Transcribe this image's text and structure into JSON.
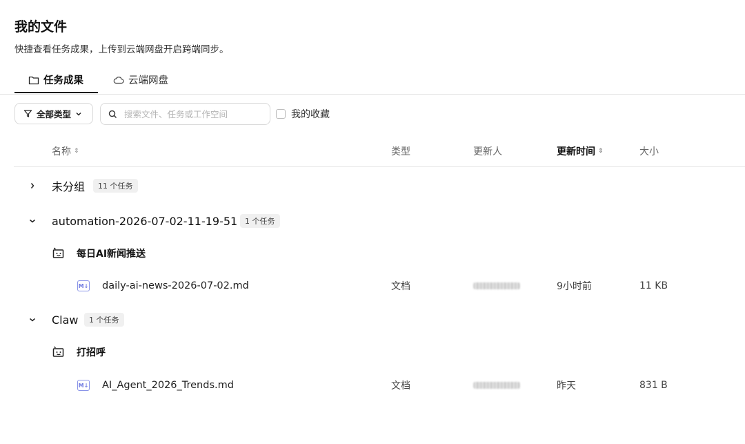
{
  "page": {
    "title": "我的文件",
    "subtitle": "快捷查看任务成果，上传到云端网盘开启跨端同步。"
  },
  "tabs": [
    {
      "label": "任务成果",
      "icon": "folder-icon",
      "active": true
    },
    {
      "label": "云端网盘",
      "icon": "cloud-icon",
      "active": false
    }
  ],
  "toolbar": {
    "filter_label": "全部类型",
    "search_placeholder": "搜索文件、任务或工作空间",
    "search_value": "",
    "favorites_label": "我的收藏",
    "favorites_checked": false
  },
  "table": {
    "columns": {
      "name": "名称",
      "type": "类型",
      "updater": "更新人",
      "updated_time": "更新时间",
      "size": "大小"
    },
    "sort_icon": "sort-icon"
  },
  "groups": [
    {
      "name": "未分组",
      "badge": "11 个任务",
      "expanded": false
    },
    {
      "name": "automation-2026-07-02-11-19-51",
      "badge": "1 个任务",
      "expanded": true,
      "task": {
        "name": "每日AI新闻推送",
        "file": {
          "name": "daily-ai-news-2026-07-02.md",
          "icon_text": "M↓",
          "type": "文档",
          "time": "9小时前",
          "size": "11 KB"
        }
      }
    },
    {
      "name": "Claw",
      "badge": "1 个任务",
      "expanded": true,
      "task": {
        "name": "打招呼",
        "file": {
          "name": "AI_Agent_2026_Trends.md",
          "icon_text": "M↓",
          "type": "文档",
          "time": "昨天",
          "size": "831 B"
        }
      }
    }
  ],
  "colors": {
    "accent_text": "#111111",
    "muted_text": "#666666",
    "border": "#d9d9d9",
    "md_icon": "#6f7ae0",
    "badge_bg": "#f0f0f0"
  }
}
